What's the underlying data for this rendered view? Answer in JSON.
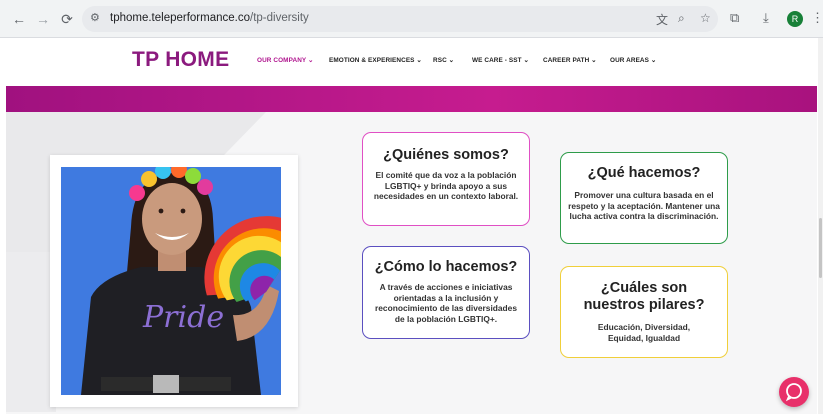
{
  "browser": {
    "url_domain": "tphome.teleperformance.co",
    "url_path": "/tp-diversity",
    "profile_initial": "R"
  },
  "site": {
    "logo": "TP HOME",
    "menu": [
      {
        "label": "OUR COMPANY ⌄",
        "active": true
      },
      {
        "label": "EMOTION & EXPERIENCES ⌄"
      },
      {
        "label": "RSC ⌄"
      },
      {
        "label": "WE CARE - SST ⌄"
      },
      {
        "label": "CAREER PATH ⌄"
      },
      {
        "label": "OUR AREAS ⌄"
      }
    ],
    "accent_color": "#b0158f"
  },
  "cards": [
    {
      "title": "¿Quiénes somos?",
      "text": "El comité que da voz a la población LGBTIQ+ y brinda apoyo a sus necesidades en un contexto laboral.",
      "border": "#e04fc4"
    },
    {
      "title": "¿Qué hacemos?",
      "text": "Promover una cultura basada en el respeto y la aceptación. Mantener una lucha activa contra la discriminación.",
      "border": "#2e9c4a"
    },
    {
      "title": "¿Cómo lo hacemos?",
      "text": "A través de acciones e iniciativas orientadas a la inclusión y reconocimiento de las diversidades de la población LGBTIQ+.",
      "border": "#5b4fc0"
    },
    {
      "title": "¿Cuáles son nuestros pilares?",
      "text": "Educación, Diversidad, Equidad, Igualdad",
      "border": "#f0cf3a"
    }
  ],
  "photo": {
    "shirt_text": "Pride"
  },
  "icons": [
    "back-icon",
    "forward-icon",
    "reload-icon",
    "site-settings-icon",
    "translate-icon",
    "zoom-icon",
    "star-icon",
    "extensions-icon",
    "download-icon",
    "menu-icon",
    "chat-icon"
  ]
}
